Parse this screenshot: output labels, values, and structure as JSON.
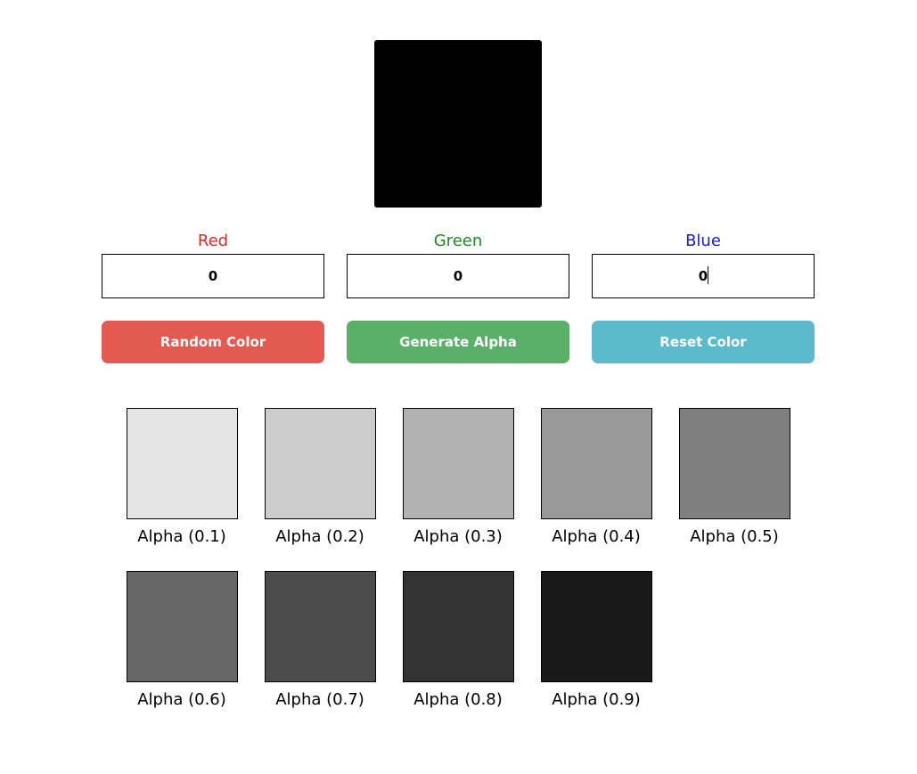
{
  "preview": {
    "color": "#000000"
  },
  "channels": [
    {
      "label": "Red",
      "value": "0",
      "color": "#e0271e"
    },
    {
      "label": "Green",
      "value": "0",
      "color": "#1f8a1f"
    },
    {
      "label": "Blue",
      "value": "0",
      "color": "#1a1adf"
    }
  ],
  "buttons": [
    {
      "label": "Random Color",
      "color": "#e35b50"
    },
    {
      "label": "Generate Alpha",
      "color": "#5aaf69"
    },
    {
      "label": "Reset Color",
      "color": "#5bbbcc"
    }
  ],
  "swatches": [
    {
      "label": "Alpha (0.1)",
      "alpha": 0.1
    },
    {
      "label": "Alpha (0.2)",
      "alpha": 0.2
    },
    {
      "label": "Alpha (0.3)",
      "alpha": 0.3
    },
    {
      "label": "Alpha (0.4)",
      "alpha": 0.4
    },
    {
      "label": "Alpha (0.5)",
      "alpha": 0.5
    },
    {
      "label": "Alpha (0.6)",
      "alpha": 0.6
    },
    {
      "label": "Alpha (0.7)",
      "alpha": 0.7
    },
    {
      "label": "Alpha (0.8)",
      "alpha": 0.8
    },
    {
      "label": "Alpha (0.9)",
      "alpha": 0.9
    }
  ]
}
